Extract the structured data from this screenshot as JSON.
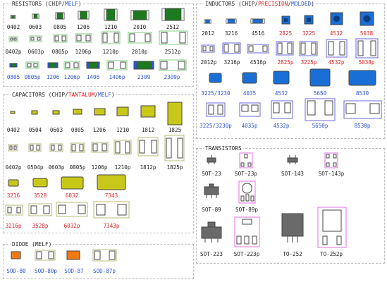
{
  "colors": {
    "resistor_body": "#1e7a1e",
    "capacitor_body": "#c8c81a",
    "tantalum_body": "#c8c81a",
    "inductor_body": "#1a6fd6",
    "diode_body": "#f07a10",
    "transistor_body": "#6a6a6a",
    "chip_footprint_outline": "#7ccf7c",
    "cap_footprint_outline": "#b8b87a",
    "inductor_footprint_outline": "#6a6ad8",
    "transistor_footprint_outline": "#e070e0",
    "label_red": "#e02020",
    "label_blue": "#2b55d6"
  },
  "sections": {
    "resistors": {
      "title_parts": [
        {
          "text": "RESISTORS (CHIP/",
          "color": "black"
        },
        {
          "text": "MELF",
          "color": "blue"
        },
        {
          "text": ")",
          "color": "black"
        }
      ],
      "items": [
        {
          "label": "0402",
          "color": "black",
          "icon": "resistor-chip-icon"
        },
        {
          "label": "0603",
          "color": "black",
          "icon": "resistor-chip-icon"
        },
        {
          "label": "0805",
          "color": "black",
          "icon": "resistor-chip-icon"
        },
        {
          "label": "1206",
          "color": "black",
          "icon": "resistor-chip-icon"
        },
        {
          "label": "1210",
          "color": "black",
          "icon": "resistor-chip-icon"
        },
        {
          "label": "2010",
          "color": "black",
          "icon": "resistor-chip-icon"
        },
        {
          "label": "2512",
          "color": "black",
          "icon": "resistor-chip-icon"
        },
        {
          "label": "0402p",
          "color": "black",
          "icon": "resistor-footprint-icon"
        },
        {
          "label": "0603p",
          "color": "black",
          "icon": "resistor-footprint-icon"
        },
        {
          "label": "0805p",
          "color": "black",
          "icon": "resistor-footprint-icon"
        },
        {
          "label": "1206p",
          "color": "black",
          "icon": "resistor-footprint-icon"
        },
        {
          "label": "1210p",
          "color": "black",
          "icon": "resistor-footprint-icon"
        },
        {
          "label": "2010p",
          "color": "black",
          "icon": "resistor-footprint-icon"
        },
        {
          "label": "2512p",
          "color": "black",
          "icon": "resistor-footprint-icon"
        },
        {
          "label": "0805",
          "color": "blue",
          "icon": "resistor-melf-icon"
        },
        {
          "label": "0805p",
          "color": "blue",
          "icon": "resistor-melf-icon"
        },
        {
          "label": "1206",
          "color": "blue",
          "icon": "resistor-melf-icon"
        },
        {
          "label": "1206p",
          "color": "blue",
          "icon": "resistor-melf-icon"
        },
        {
          "label": "1406",
          "color": "blue",
          "icon": "resistor-melf-icon"
        },
        {
          "label": "1406p",
          "color": "blue",
          "icon": "resistor-melf-icon"
        },
        {
          "label": "2309",
          "color": "blue",
          "icon": "resistor-melf-icon"
        },
        {
          "label": "2309p",
          "color": "blue",
          "icon": "resistor-melf-icon"
        }
      ]
    },
    "capacitors": {
      "title_parts": [
        {
          "text": "CAPACITORS (CHIP/",
          "color": "black"
        },
        {
          "text": "TANTALUM",
          "color": "red"
        },
        {
          "text": "/",
          "color": "black"
        },
        {
          "text": "MELF",
          "color": "blue"
        },
        {
          "text": ")",
          "color": "black"
        }
      ],
      "items": [
        {
          "label": "0402",
          "color": "black"
        },
        {
          "label": "0504",
          "color": "black"
        },
        {
          "label": "0603",
          "color": "black"
        },
        {
          "label": "0805",
          "color": "black"
        },
        {
          "label": "1206",
          "color": "black"
        },
        {
          "label": "1210",
          "color": "black"
        },
        {
          "label": "1812",
          "color": "black"
        },
        {
          "label": "1825",
          "color": "black"
        },
        {
          "label": "0402p",
          "color": "black"
        },
        {
          "label": "0504p",
          "color": "black"
        },
        {
          "label": "0603p",
          "color": "black"
        },
        {
          "label": "0805p",
          "color": "black"
        },
        {
          "label": "1206p",
          "color": "black"
        },
        {
          "label": "1210p",
          "color": "black"
        },
        {
          "label": "1812p",
          "color": "black"
        },
        {
          "label": "1825p",
          "color": "black"
        },
        {
          "label": "3216",
          "color": "red"
        },
        {
          "label": "3528",
          "color": "red"
        },
        {
          "label": "6032",
          "color": "red"
        },
        {
          "label": "7343",
          "color": "red"
        },
        {
          "label": "3216p",
          "color": "red"
        },
        {
          "label": "3528p",
          "color": "red"
        },
        {
          "label": "6032p",
          "color": "red"
        },
        {
          "label": "7343p",
          "color": "red"
        }
      ]
    },
    "diode": {
      "title_parts": [
        {
          "text": "DIODE (MELF)",
          "color": "black"
        }
      ],
      "items": [
        {
          "label": "SOD-80",
          "color": "blue"
        },
        {
          "label": "SOD-80p",
          "color": "blue"
        },
        {
          "label": "SOD-87",
          "color": "blue"
        },
        {
          "label": "SOD-87p",
          "color": "blue"
        }
      ]
    },
    "inductors": {
      "title_parts": [
        {
          "text": "INDUCTORS (CHIP/",
          "color": "black"
        },
        {
          "text": "PRECISION",
          "color": "red"
        },
        {
          "text": "/",
          "color": "black"
        },
        {
          "text": "MOLDED",
          "color": "blue"
        },
        {
          "text": ")",
          "color": "black"
        }
      ],
      "items": [
        {
          "label": "2012",
          "color": "black"
        },
        {
          "label": "3216",
          "color": "black"
        },
        {
          "label": "4516",
          "color": "black"
        },
        {
          "label": "2825",
          "color": "red"
        },
        {
          "label": "3225",
          "color": "red"
        },
        {
          "label": "4532",
          "color": "red"
        },
        {
          "label": "5038",
          "color": "red"
        },
        {
          "label": "2012p",
          "color": "black"
        },
        {
          "label": "3216p",
          "color": "black"
        },
        {
          "label": "4516p",
          "color": "black"
        },
        {
          "label": "2825p",
          "color": "red"
        },
        {
          "label": "3225p",
          "color": "red"
        },
        {
          "label": "4532p",
          "color": "red"
        },
        {
          "label": "5038p",
          "color": "red"
        },
        {
          "label": "3225/3230",
          "color": "blue"
        },
        {
          "label": "4035",
          "color": "blue"
        },
        {
          "label": "4532",
          "color": "blue"
        },
        {
          "label": "5650",
          "color": "blue"
        },
        {
          "label": "8530",
          "color": "blue"
        },
        {
          "label": "3225/3230p",
          "color": "blue"
        },
        {
          "label": "4035p",
          "color": "blue"
        },
        {
          "label": "4532p",
          "color": "blue"
        },
        {
          "label": "5650p",
          "color": "blue"
        },
        {
          "label": "8530p",
          "color": "blue"
        }
      ]
    },
    "transistors": {
      "title_parts": [
        {
          "text": "TRANSISTORS",
          "color": "black"
        }
      ],
      "items": [
        {
          "label": "SOT-23",
          "color": "black"
        },
        {
          "label": "SOT-23p",
          "color": "black"
        },
        {
          "label": "SOT-143",
          "color": "black"
        },
        {
          "label": "SOT-143p",
          "color": "black"
        },
        {
          "label": "SOT-89",
          "color": "black"
        },
        {
          "label": "SOT-89p",
          "color": "black"
        },
        {
          "label": "SOT-223",
          "color": "black"
        },
        {
          "label": "SOT-223p",
          "color": "black"
        },
        {
          "label": "TO-252",
          "color": "black"
        },
        {
          "label": "TO-252p",
          "color": "black"
        }
      ]
    }
  }
}
